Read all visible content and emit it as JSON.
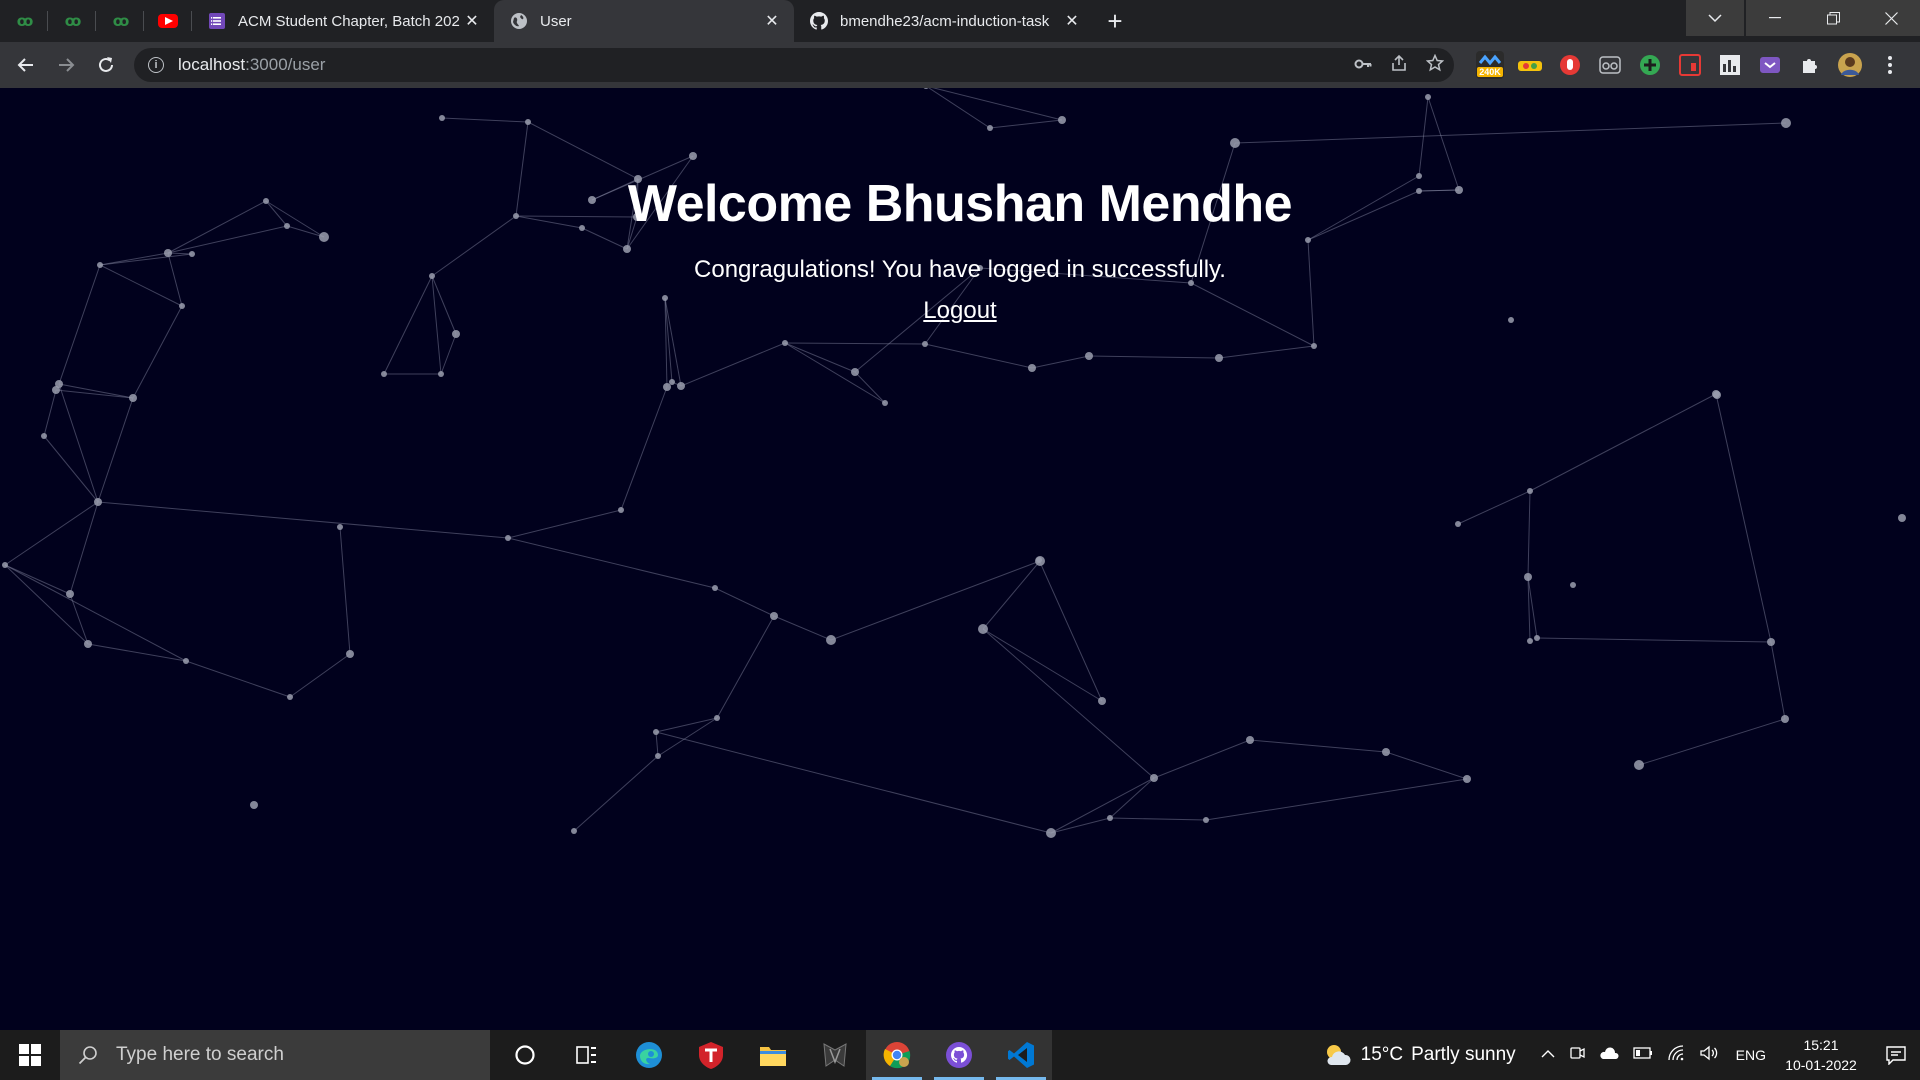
{
  "browser": {
    "pinned_tabs": [
      {
        "icon": "geeksforgeeks-icon",
        "glyph": "ꝏ"
      },
      {
        "icon": "geeksforgeeks-icon",
        "glyph": "ꝏ"
      },
      {
        "icon": "geeksforgeeks-icon",
        "glyph": "ꝏ"
      },
      {
        "icon": "youtube-icon"
      }
    ],
    "tabs": [
      {
        "title": "ACM Student Chapter, Batch 202",
        "icon": "forms-icon",
        "active": false
      },
      {
        "title": "User",
        "icon": "globe-icon",
        "active": true
      },
      {
        "title": "bmendhe23/acm-induction-task",
        "icon": "github-icon",
        "active": false
      }
    ],
    "new_tab_label": "+",
    "close_glyph": "✕",
    "url_host": "localhost",
    "url_path": ":3000/user",
    "extension_badge": "240K"
  },
  "page": {
    "headline": "Welcome Bhushan Mendhe",
    "message": "Congragulations! You have logged in successfully.",
    "logout_label": "Logout",
    "background_color": "#01011d",
    "text_color": "#ffffff"
  },
  "taskbar": {
    "search_placeholder": "Type here to search",
    "weather_temp": "15°C",
    "weather_condition": "Partly sunny",
    "language": "ENG",
    "time": "15:21",
    "date": "10-01-2022"
  }
}
